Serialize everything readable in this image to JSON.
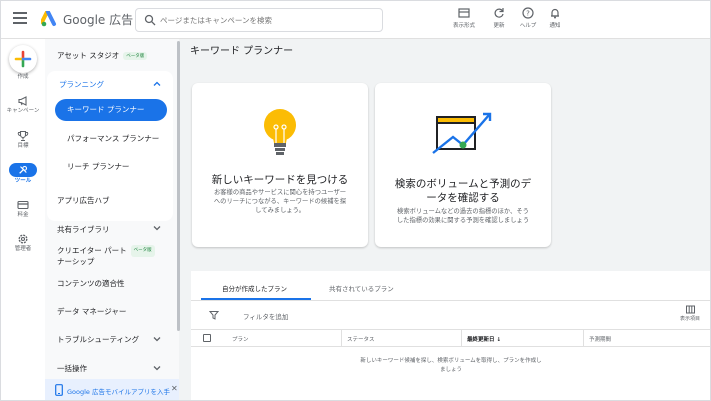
{
  "header": {
    "brand": "Google 広告",
    "search_placeholder": "ページまたはキャンペーンを検索",
    "tools": [
      {
        "label": "表示形式",
        "icon": "display-icon"
      },
      {
        "label": "更新",
        "icon": "refresh-icon"
      },
      {
        "label": "ヘルプ",
        "icon": "help-icon"
      },
      {
        "label": "通知",
        "icon": "bell-icon"
      }
    ]
  },
  "rail": {
    "items": [
      {
        "label": "作成",
        "icon": "plus-icon"
      },
      {
        "label": "キャンペーン",
        "icon": "megaphone-icon"
      },
      {
        "label": "目標",
        "icon": "trophy-icon"
      },
      {
        "label": "ツール",
        "icon": "tools-icon",
        "active": true
      },
      {
        "label": "料金",
        "icon": "billing-icon"
      },
      {
        "label": "管理者",
        "icon": "admin-gear-icon"
      }
    ]
  },
  "sidenav": {
    "asset_studio": "アセット スタジオ",
    "beta": "ベータ版",
    "planning": "プランニング",
    "planning_items": [
      "キーワード プランナー",
      "パフォーマンス プランナー",
      "リーチ プランナー"
    ],
    "items": [
      "アプリ広告ハブ",
      "共有ライブラリ",
      "クリエイター パートナーシップ",
      "コンテンツの適合性",
      "データ マネージャー",
      "トラブルシューティング",
      "一括操作"
    ],
    "creator_line1": "クリエイター パート",
    "creator_line2": "ナーシップ",
    "promo": "Google 広告モバイルアプリを入手"
  },
  "main": {
    "title": "キーワード プランナー",
    "card1": {
      "title": "新しいキーワードを見つける",
      "desc_line1": "お客様の商品やサービスに関心を持つユーザー",
      "desc_line2": "へのリーチにつながる、キーワードの候補を探",
      "desc_line3": "してみましょう。"
    },
    "card2": {
      "title_line1": "検索のボリュームと予測のデ",
      "title_line2": "ータを確認する",
      "desc_line1": "検索ボリュームなどの過去の指標のほか、そう",
      "desc_line2": "した指標の効果に関する予測を確認しましょう"
    },
    "tabs": [
      "自分が作成したプラン",
      "共有されているプラン"
    ],
    "filter": "フィルタを追加",
    "columns_button": "表示項目",
    "table_headers": [
      "プラン",
      "ステータス",
      "最終更新日",
      "予測期間"
    ],
    "empty_line1": "新しいキーワード候補を探し、検索ボリュームを取得し、プランを作成し",
    "empty_line2": "ましょう"
  },
  "colors": {
    "accent": "#1a73e8",
    "background": "#f1f3f4",
    "beta_green": "#188038"
  }
}
